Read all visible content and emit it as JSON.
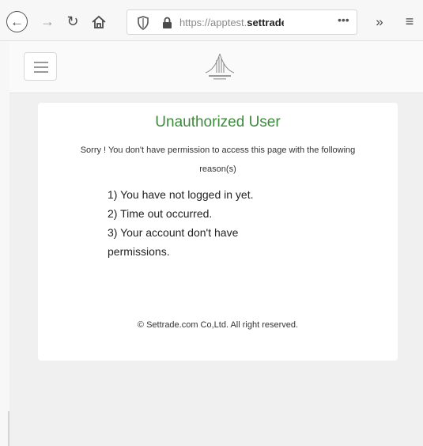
{
  "browser": {
    "url_prefix": "https://apptest.",
    "url_domain": "settrade.com",
    "url_suffix": "/",
    "icons": {
      "back": "back-arrow-icon",
      "forward": "forward-arrow-icon",
      "reload": "reload-icon",
      "home": "home-icon",
      "tracking": "shield-icon",
      "secure": "lock-icon",
      "more": "more-dots-icon",
      "overflow": "overflow-chevrons-icon",
      "menu": "hamburger-menu-icon"
    }
  },
  "site": {
    "menu_icon": "hamburger-icon",
    "logo_icon": "settrade-logo-icon"
  },
  "error": {
    "title": "Unauthorized User",
    "message": "Sorry ! You don't have permission to access this page with the following",
    "reason_label": "reason(s)",
    "reasons": [
      "1) You have not logged in yet.",
      "2) Time out occurred.",
      "3) Your account don't have",
      "permissions."
    ],
    "footer": "© Settrade.com Co,Ltd. All right reserved."
  },
  "colors": {
    "title_green": "#3c8a3c",
    "card_background": "#ffffff",
    "page_background": "#f0f0f0"
  }
}
